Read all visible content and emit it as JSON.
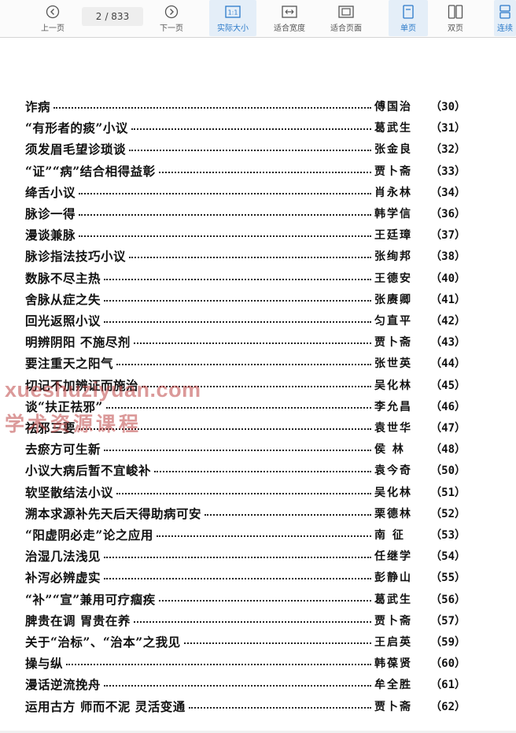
{
  "toolbar": {
    "prev_label": "上一页",
    "next_label": "下一页",
    "page_current": "2",
    "page_total": "/ 833",
    "actual_size_label": "实际大小",
    "fit_width_label": "适合宽度",
    "fit_page_label": "适合页面",
    "single_page_label": "单页",
    "double_page_label": "双页",
    "continuous_label": "连续",
    "actual_size_icon_text": "1:1",
    "accent_color": "#2a79c9"
  },
  "watermark": {
    "line1": "xueshuziyuan.com",
    "line2": "学术资源课程"
  },
  "toc": [
    {
      "title": "诈病",
      "author": "傅国治",
      "page": "（30）"
    },
    {
      "title": "“有形者的痰”小议",
      "author": "葛武生",
      "page": "（31）"
    },
    {
      "title": "须发眉毛望诊琐谈",
      "author": "张金良",
      "page": "（32）"
    },
    {
      "title": "“证”“病”结合相得益彰",
      "author": "贾卜斋",
      "page": "（33）"
    },
    {
      "title": "绛舌小议",
      "author": "肖永林",
      "page": "（34）"
    },
    {
      "title": "脉诊一得",
      "author": "韩学信",
      "page": "（36）"
    },
    {
      "title": "漫谈兼脉",
      "author": "王廷璋",
      "page": "（37）"
    },
    {
      "title": "脉诊指法技巧小议",
      "author": "张绚邦",
      "page": "（38）"
    },
    {
      "title": "数脉不尽主热",
      "author": "王德安",
      "page": "（40）"
    },
    {
      "title": "舍脉从症之失",
      "author": "张赓卿",
      "page": "（41）"
    },
    {
      "title": "回光返照小议",
      "author": "匀直平",
      "page": "（42）"
    },
    {
      "title": "明辨阴阳 不施尽剂",
      "author": "贾卜斋",
      "page": "（43）"
    },
    {
      "title": "要注重天之阳气",
      "author": "张世英",
      "page": "（44）"
    },
    {
      "title": "切记不加辨证而施治",
      "author": "吴化林",
      "page": "（45）"
    },
    {
      "title": "谈“扶正祛邪”",
      "author": "李允昌",
      "page": "（46）"
    },
    {
      "title": "祛邪三要",
      "author": "袁世华",
      "page": "（47）"
    },
    {
      "title": "去瘀方可生新",
      "author": "侯  林",
      "page": "（48）"
    },
    {
      "title": "小议大病后暂不宜峻补",
      "author": "袁今奇",
      "page": "（50）"
    },
    {
      "title": "软坚散结法小议",
      "author": "吴化林",
      "page": "（51）"
    },
    {
      "title": "溯本求源补先天后天得助病可安",
      "author": "栗德林",
      "page": "（52）"
    },
    {
      "title": "“阳虚阴必走”论之应用",
      "author": "南  征",
      "page": "（53）"
    },
    {
      "title": "治湿几法浅见",
      "author": "任继学",
      "page": "（54）"
    },
    {
      "title": "补泻必辨虚实",
      "author": "彭静山",
      "page": "（55）"
    },
    {
      "title": "“补”“宣”兼用可疗痼疾",
      "author": "葛武生",
      "page": "（56）"
    },
    {
      "title": "脾贵在调 胃贵在养",
      "author": "贾卜斋",
      "page": "（57）"
    },
    {
      "title": "关于“治标”、“治本”之我见",
      "author": "王启英",
      "page": "（59）"
    },
    {
      "title": "操与纵",
      "author": "韩葆贤",
      "page": "（60）"
    },
    {
      "title": "漫话逆流挽舟",
      "author": "牟全胜",
      "page": "（61）"
    },
    {
      "title": "运用古方 师而不泥 灵活变通",
      "author": "贾卜斋",
      "page": "（62）"
    }
  ]
}
